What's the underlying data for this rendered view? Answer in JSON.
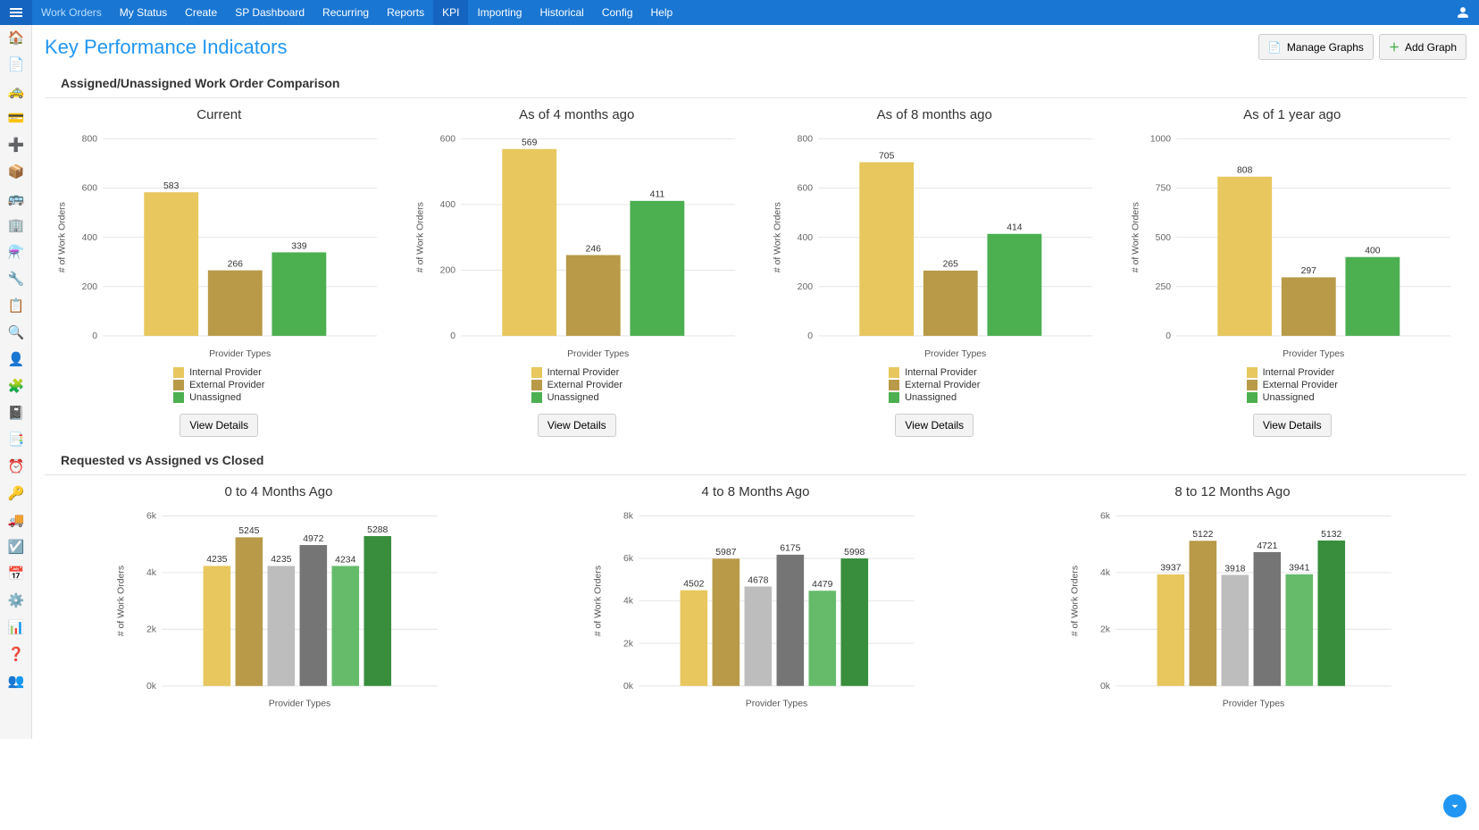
{
  "nav": {
    "items": [
      {
        "label": "Work Orders",
        "dim": true,
        "active": false
      },
      {
        "label": "My Status",
        "dim": false,
        "active": false
      },
      {
        "label": "Create",
        "dim": false,
        "active": false
      },
      {
        "label": "SP Dashboard",
        "dim": false,
        "active": false
      },
      {
        "label": "Recurring",
        "dim": false,
        "active": false
      },
      {
        "label": "Reports",
        "dim": false,
        "active": false
      },
      {
        "label": "KPI",
        "dim": false,
        "active": true
      },
      {
        "label": "Importing",
        "dim": false,
        "active": false
      },
      {
        "label": "Historical",
        "dim": false,
        "active": false
      },
      {
        "label": "Config",
        "dim": false,
        "active": false
      },
      {
        "label": "Help",
        "dim": false,
        "active": false
      }
    ]
  },
  "sidebar_icons": [
    "🏠",
    "📄",
    "🚕",
    "💳",
    "➕",
    "📦",
    "🚌",
    "🏢",
    "⚗️",
    "🔧",
    "📋",
    "🔍",
    "👤",
    "🧩",
    "📓",
    "📑",
    "⏰",
    "🔑",
    "🚚",
    "☑️",
    "📅",
    "⚙️",
    "📊",
    "❓",
    "👥"
  ],
  "page_title": "Key Performance Indicators",
  "buttons": {
    "manage": "Manage Graphs",
    "add": "Add Graph",
    "view": "View Details"
  },
  "sections": {
    "s1": "Assigned/Unassigned Work Order Comparison",
    "s2": "Requested vs Assigned vs Closed"
  },
  "legend_labels": {
    "internal": "Internal Provider",
    "external": "External Provider",
    "unassigned": "Unassigned"
  },
  "colors": {
    "internal": "#e7c75e",
    "external": "#b89a48",
    "unassigned": "#4caf50",
    "grey_light": "#bdbdbd",
    "grey_dark": "#757575",
    "green_light": "#66bb6a",
    "green_dark": "#388e3c"
  },
  "xlabel": "Provider Types",
  "ylabel": "# of Work Orders",
  "chart_data": {
    "section1": [
      {
        "title": "Current",
        "ymax": 800,
        "ystep": 200,
        "values": [
          583,
          266,
          339
        ]
      },
      {
        "title": "As of 4 months ago",
        "ymax": 600,
        "ystep": 200,
        "values": [
          569,
          246,
          411
        ]
      },
      {
        "title": "As of 8 months ago",
        "ymax": 800,
        "ystep": 200,
        "values": [
          705,
          265,
          414
        ]
      },
      {
        "title": "As of 1 year ago",
        "ymax": 1000,
        "ystep": 250,
        "values": [
          808,
          297,
          400
        ]
      }
    ],
    "section2": [
      {
        "title": "0 to 4 Months Ago",
        "ymax": 6000,
        "ystep": 2000,
        "tick_fmt": "k",
        "values": [
          4235,
          5245,
          4235,
          4972,
          4234,
          5288
        ]
      },
      {
        "title": "4 to 8 Months Ago",
        "ymax": 8000,
        "ystep": 2000,
        "tick_fmt": "k",
        "values": [
          4502,
          5987,
          4678,
          6175,
          4479,
          5998
        ]
      },
      {
        "title": "8 to 12 Months Ago",
        "ymax": 6000,
        "ystep": 2000,
        "tick_fmt": "k",
        "values": [
          3937,
          5122,
          3918,
          4721,
          3941,
          5132
        ]
      }
    ]
  }
}
